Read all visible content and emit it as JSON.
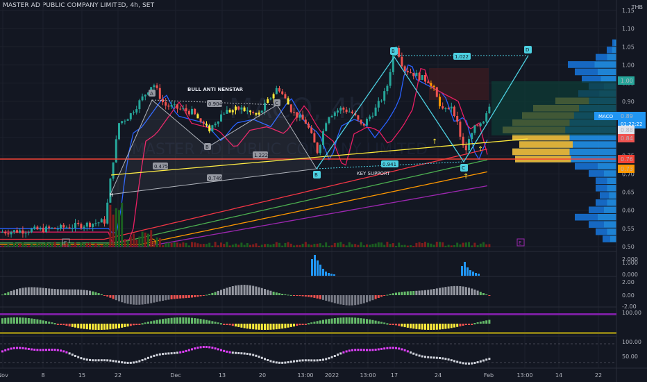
{
  "header": {
    "title": "MASTER AD PUBLIC COMPANY LIMITED, 4h, SET",
    "currency": "THB"
  },
  "watermark": {
    "symbol": "MACO, 4h",
    "name": "MASTER AD PUBLIC COMPANY LIMITED"
  },
  "price_axis": {
    "ticks": [
      "1.15",
      "1.10",
      "1.05",
      "1.00",
      "0.95",
      "0.90",
      "0.85",
      "0.80",
      "0.75",
      "0.70",
      "0.65",
      "0.60",
      "0.55",
      "0.50"
    ]
  },
  "price_tags": {
    "tag_top": "1.00",
    "symbol": "MACO",
    "last": "0.89",
    "countdown": "01:22:22",
    "t088": "0.88",
    "t084": "0.84",
    "t076": "0.76",
    "t073": "0.73"
  },
  "time_axis": {
    "labels": [
      "Nov",
      "8",
      "15",
      "22",
      "Dec",
      "13",
      "20",
      "13:00",
      "2022",
      "13:00",
      "17",
      "24",
      "Feb",
      "13:00",
      "14",
      "22"
    ]
  },
  "annotations": {
    "pattern_title": "BULL ANTI NENSTAR",
    "point_a": "A",
    "point_b": "B",
    "point_c": "C",
    "point_d": "D",
    "ratio_0904": "0.904",
    "ratio_1222": "1.222",
    "ratio_0475": "0.475",
    "ratio_0749": "0.749",
    "ratio_0941": "0.941",
    "ratio_1022": "1.022",
    "point_b2": "B",
    "point_b3": "B",
    "point_c2": "C",
    "key_support": "KEY SUPPORT",
    "marker_e1": "E",
    "marker_s": "S",
    "marker_e2": "E",
    "marker_h": "H"
  },
  "panes": {
    "p1_ticks": [
      "2.000",
      "1.000",
      "0.000"
    ],
    "p2_ticks": [
      "2.00",
      "0.00",
      "-2.00"
    ],
    "p3_ticks": [
      "100.00"
    ],
    "p4_ticks": [
      "100.00",
      "50.00"
    ]
  },
  "colors": {
    "bg": "#131722",
    "up": "#26a69a",
    "down": "#ef5350",
    "pattern": "#4dd0e1",
    "support": "#f44336",
    "trend": "#ffeb3b",
    "vp_blue": "#2196f3",
    "vp_gold": "#f0b429"
  },
  "chart_data": {
    "type": "candlestick",
    "title": "MASTER AD PUBLIC COMPANY LIMITED, 4h, SET",
    "ylabel": "THB",
    "ylim": [
      0.5,
      1.15
    ],
    "x": [
      "Nov",
      "8",
      "15",
      "22",
      "Dec",
      "13",
      "20",
      "13:00",
      "2022",
      "13:00",
      "17",
      "24",
      "Feb"
    ],
    "close": [
      0.55,
      0.56,
      0.58,
      0.9,
      0.87,
      0.88,
      0.86,
      0.76,
      0.89,
      1.06,
      0.87,
      0.76,
      0.89
    ],
    "pattern_points": [
      {
        "label": "A",
        "y": 0.95
      },
      {
        "label": "B",
        "y": 0.82
      },
      {
        "label": "C",
        "y": 0.94
      },
      {
        "label": "D",
        "y": 0.76
      },
      {
        "label": "B",
        "y": 1.06
      },
      {
        "label": "C",
        "y": 0.76
      },
      {
        "label": "D",
        "y": 1.07
      }
    ],
    "levels": [
      {
        "y": 0.76,
        "label": "support"
      }
    ],
    "last_price": 0.89
  }
}
